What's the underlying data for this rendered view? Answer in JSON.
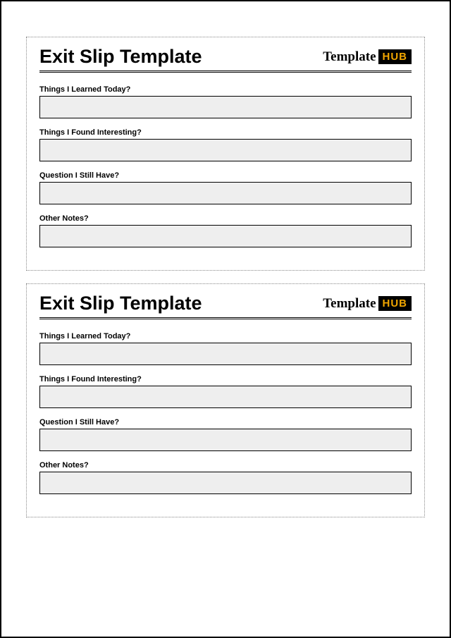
{
  "slips": [
    {
      "title": "Exit Slip Template",
      "logo": {
        "part1": "Template",
        "part2": "HUB"
      },
      "fields": [
        {
          "label": "Things I Learned Today?"
        },
        {
          "label": "Things I Found Interesting?"
        },
        {
          "label": "Question I Still Have?"
        },
        {
          "label": "Other Notes?"
        }
      ]
    },
    {
      "title": "Exit Slip Template",
      "logo": {
        "part1": "Template",
        "part2": "HUB"
      },
      "fields": [
        {
          "label": "Things I Learned Today?"
        },
        {
          "label": "Things I Found Interesting?"
        },
        {
          "label": "Question I Still Have?"
        },
        {
          "label": "Other Notes?"
        }
      ]
    }
  ]
}
